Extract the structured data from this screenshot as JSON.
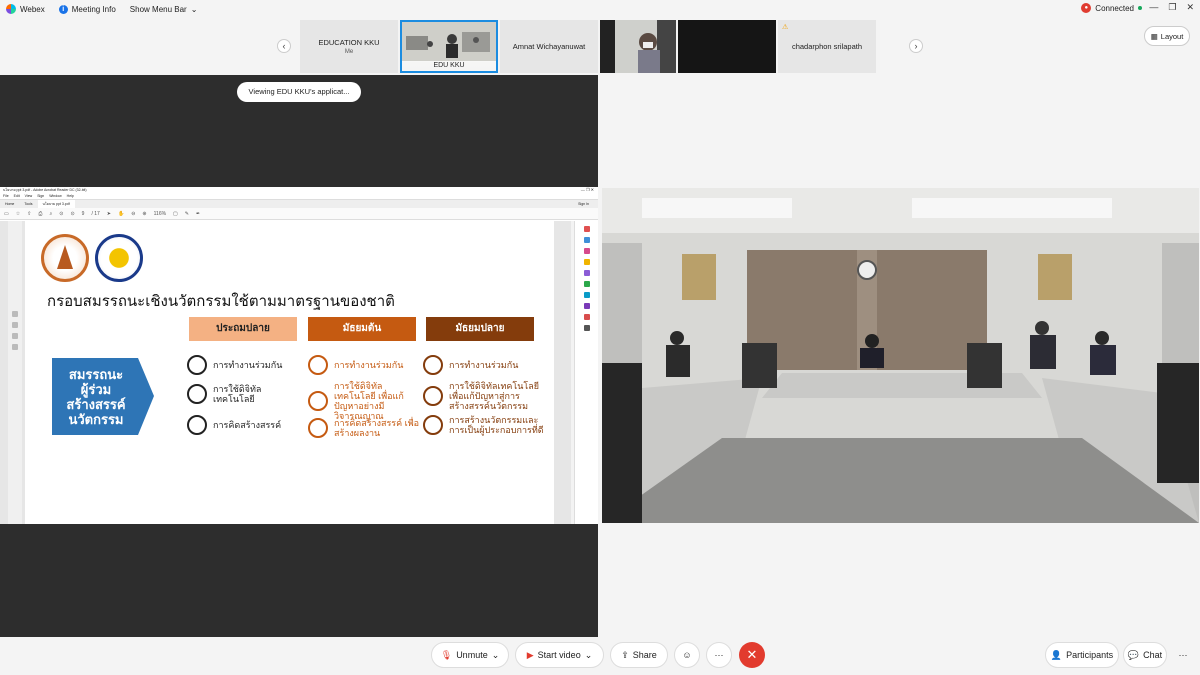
{
  "titlebar": {
    "app": "Webex",
    "meeting_info": "Meeting Info",
    "show_menu": "Show Menu Bar",
    "status": "Connected"
  },
  "participants_strip": [
    {
      "name": "EDUCATION KKU",
      "sub": "Me"
    },
    {
      "name": "EDU KKU"
    },
    {
      "name": "Amnat Wichayanuwat"
    },
    {
      "name": "chadarphon srilapath"
    }
  ],
  "layout_label": "Layout",
  "viewing_pill": "Viewing EDU KKU's applicat...",
  "acrobat": {
    "title": "นโยบาย ppt 3.pdf - Adobe Acrobat Reader DC (32-bit)",
    "menu": [
      "File",
      "Edit",
      "View",
      "Sign",
      "Window",
      "Help"
    ],
    "tabs": [
      "Home",
      "Tools",
      "นโยบาย ppt 3.pdf"
    ],
    "sign_in": "Sign In",
    "page": "9",
    "pages": "/ 17",
    "zoom": "116%"
  },
  "slide": {
    "title": "กรอบสมรรถนะเชิงนวัตกรรมใช้ตามมาตรฐานของชาติ",
    "headers": [
      "ประถมปลาย",
      "มัธยมต้น",
      "มัธยมปลาย"
    ],
    "arrow_lines": [
      "สมรรถนะ",
      "ผู้ร่วม",
      "สร้างสรรค์",
      "นวัตกรรม"
    ],
    "col1": [
      "การทำงานร่วมกัน",
      "การใช้ดิจิทัล เทคโนโลยี",
      "การคิดสร้างสรรค์"
    ],
    "col2": [
      "การทำงานร่วมกัน",
      "การใช้ดิจิทัลเทคโนโลยี เพื่อแก้ปัญหาอย่างมี วิจารณญาณ",
      "การคิดสร้างสรรค์ เพื่อสร้างผลงาน"
    ],
    "col3": [
      "การทำงานร่วมกัน",
      "การใช้ดิจิทัลเทคโนโลยี เพื่อแก้ปัญหาสู่การ สร้างสรรค์นวัตกรรม",
      "การสร้างนวัตกรรมและ การเป็นผู้ประกอบการที่ดี"
    ]
  },
  "controls": {
    "mute": "Unmute",
    "video": "Start video",
    "share": "Share",
    "participants": "Participants",
    "chat": "Chat"
  },
  "colors": {
    "accent": "#1b8ce0",
    "end": "#e23b2e",
    "orange_light": "#f4b183",
    "orange": "#c55a11",
    "brown": "#843c0c",
    "arrow_blue": "#2e75b6"
  }
}
